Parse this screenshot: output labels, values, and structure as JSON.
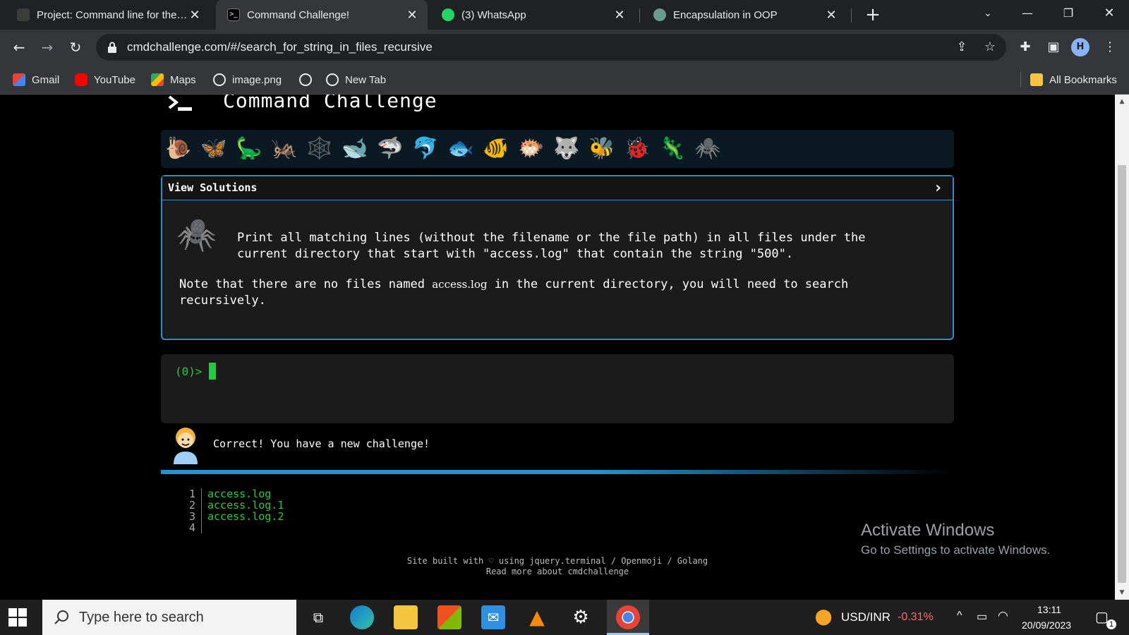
{
  "browser": {
    "tabs": [
      {
        "title": "Project: Command line for the wi"
      },
      {
        "title": "Command Challenge!"
      },
      {
        "title": "(3) WhatsApp"
      },
      {
        "title": "Encapsulation in OOP"
      }
    ],
    "url": "cmdchallenge.com/#/search_for_string_in_files_recursive",
    "avatar_letter": "H",
    "bookmarks": [
      {
        "label": "Gmail"
      },
      {
        "label": "YouTube"
      },
      {
        "label": "Maps"
      },
      {
        "label": "image.png"
      },
      {
        "label": ""
      },
      {
        "label": "New Tab"
      }
    ],
    "all_bookmarks": "All Bookmarks"
  },
  "page": {
    "site_title": "Command Challenge",
    "badges": [
      "🐌",
      "🦋",
      "🦕",
      "🦗",
      "🕸️",
      "🐋",
      "🦈",
      "🐬",
      "🐟",
      "🐠",
      "🐡",
      "🐺",
      "🐝",
      "🐞",
      "🦎",
      "🕷️"
    ],
    "solutions_label": "View Solutions",
    "task_icon": "🕷️",
    "task": "Print all matching lines (without the filename or the file path) in all files under the current directory that start with \"access.log\" that contain the string \"500\".",
    "note_before": "Note that there are no files named ",
    "note_code": "access.log",
    "note_after": " in the current directory, you will need to search recursively.",
    "prompt": "(0)>",
    "correct_message": "Correct! You have a new challenge!",
    "progress_percent": 55,
    "files": [
      {
        "num": "1",
        "name": "access.log"
      },
      {
        "num": "2",
        "name": "access.log.1"
      },
      {
        "num": "3",
        "name": "access.log.2"
      },
      {
        "num": "4",
        "name": ""
      }
    ],
    "footer_line1": "Site built with ♡ using jquery.terminal / Openmoji / Golang",
    "footer_line2": "Read more about cmdchallenge"
  },
  "watermark": {
    "line1": "Activate Windows",
    "line2": "Go to Settings to activate Windows."
  },
  "taskbar": {
    "search_placeholder": "Type here to search",
    "ticker": "USD/INR",
    "ticker_change": "-0.31%",
    "time": "13:11",
    "date": "20/09/2023",
    "notification_count": "1"
  },
  "colors": {
    "accent": "#1d94d6",
    "terminal_green": "#27c93f",
    "ticker_negative": "#ff6b6b"
  }
}
